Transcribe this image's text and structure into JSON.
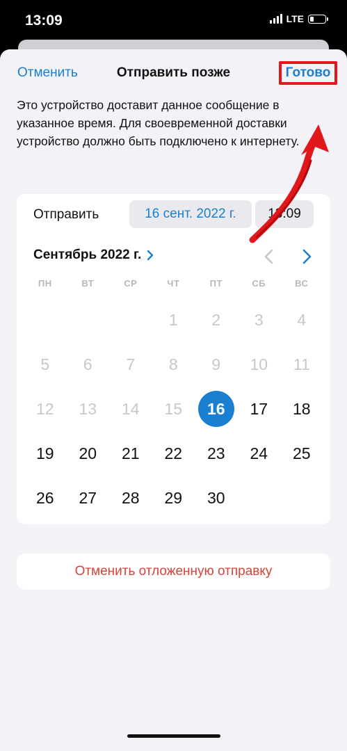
{
  "status_bar": {
    "time": "13:09",
    "network": "LTE"
  },
  "nav": {
    "cancel": "Отменить",
    "title": "Отправить позже",
    "done": "Готово"
  },
  "description": "Это устройство доставит данное сообщение в указанное время. Для своевременной доставки устройство должно быть подключено к интернету.",
  "schedule": {
    "send_label": "Отправить",
    "date": "16 сент. 2022 г.",
    "time": "13:09"
  },
  "calendar": {
    "month_label": "Сентябрь 2022 г.",
    "weekdays": [
      "ПН",
      "ВТ",
      "СР",
      "ЧТ",
      "ПТ",
      "СБ",
      "ВС"
    ],
    "leading_blanks": 3,
    "days": [
      1,
      2,
      3,
      4,
      5,
      6,
      7,
      8,
      9,
      10,
      11,
      12,
      13,
      14,
      15,
      16,
      17,
      18,
      19,
      20,
      21,
      22,
      23,
      24,
      25,
      26,
      27,
      28,
      29,
      30
    ],
    "disabled_before": 16,
    "selected_day": 16
  },
  "cancel_scheduled": "Отменить отложенную отправку",
  "colors": {
    "accent": "#1a7fd0",
    "destructive": "#d9423b",
    "annotation": "#e0181b"
  }
}
